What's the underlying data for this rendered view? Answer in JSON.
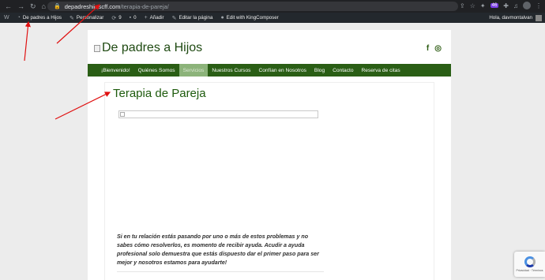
{
  "browser": {
    "nav_back": "←",
    "nav_forward": "→",
    "nav_reload": "↻",
    "nav_home": "⌂",
    "url_host": "depadreshijoscff.com",
    "url_path": "/terapia-de-pareja/",
    "ext_badge": "46"
  },
  "adminbar": {
    "wp_logo": "W",
    "site_name": "De padres a Hijos",
    "customize": "Personalizar",
    "updates_count": "9",
    "comments_count": "0",
    "new_label": "Añadir",
    "edit_page": "Editar la página",
    "kingcomposer": "Edit with KingComposer",
    "greeting": "Hola, davmontalvan"
  },
  "site": {
    "logo_alt": "De padres a Hijos",
    "social": {
      "facebook": "f",
      "instagram": "◎"
    },
    "menu": [
      {
        "label": "¡Bienvenido!",
        "active": false
      },
      {
        "label": "Quiénes Somos",
        "active": false
      },
      {
        "label": "Servicios",
        "active": true
      },
      {
        "label": "Nuestros Cursos",
        "active": false
      },
      {
        "label": "Confían en Nosotros",
        "active": false
      },
      {
        "label": "Blog",
        "active": false
      },
      {
        "label": "Contacto",
        "active": false
      },
      {
        "label": "Reserva de citas",
        "active": false
      }
    ]
  },
  "content": {
    "title": "Terapia de Pareja",
    "paragraph": "Si en tu relación estás pasando por uno o más de estos problemas y no sabes cómo resolverlos, es momento de recibir ayuda. Acudir a ayuda profesional solo demuestra que estás dispuesto dar el primer paso para ser mejor y nosotros estamos para ayudarte!"
  },
  "recaptcha": {
    "text": "Privacidad · Términos"
  },
  "colors": {
    "menu_bg": "#2a5e15",
    "menu_active": "#8cb37a",
    "title": "#1e5b0d",
    "annotation_arrow": "#e01010"
  }
}
